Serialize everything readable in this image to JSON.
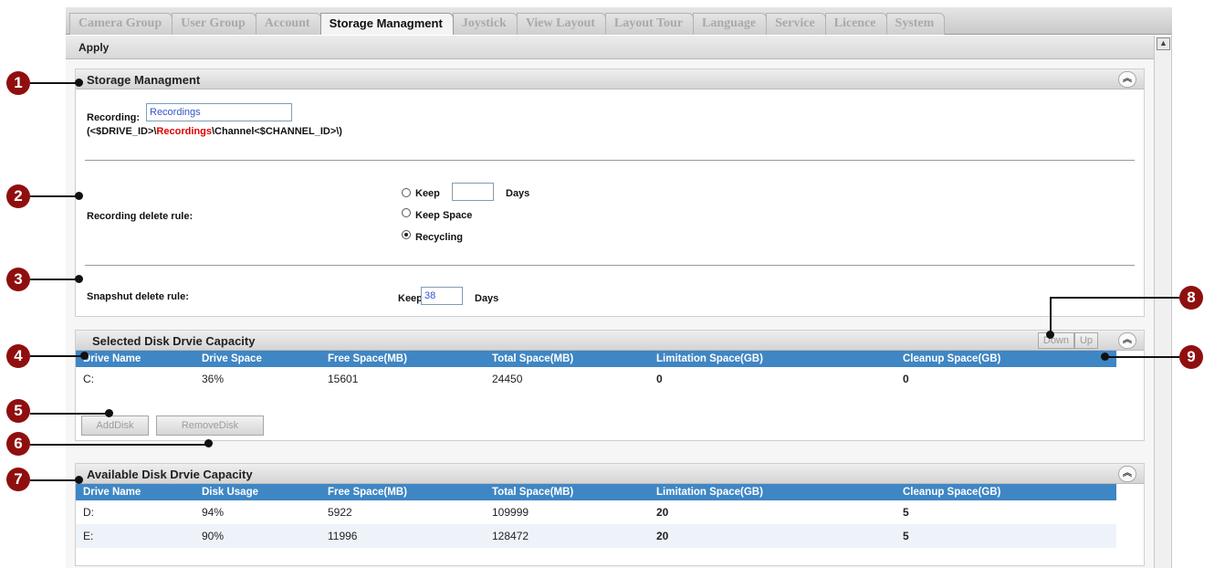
{
  "tabs": [
    "Camera Group",
    "User Group",
    "Account",
    "Storage Managment",
    "Joystick",
    "View Layout",
    "Layout Tour",
    "Language",
    "Service",
    "Licence",
    "System"
  ],
  "active_tab": "Storage Managment",
  "toolbar": {
    "apply_label": "Apply"
  },
  "storage": {
    "title": "Storage Managment",
    "recording_label": "Recording:",
    "recording_value": "Recordings",
    "path_prefix": "(<$DRIVE_ID>\\",
    "path_highlight": "Recordings",
    "path_suffix": "\\Channel<$CHANNEL_ID>\\)",
    "delete_rule_label": "Recording delete rule:",
    "options": [
      {
        "label": "Keep",
        "selected": false,
        "has_days": true,
        "days_value": "",
        "days_label": "Days"
      },
      {
        "label": "Keep Space",
        "selected": false
      },
      {
        "label": "Recycling",
        "selected": true
      }
    ],
    "snapshot_label": "Snapshut delete rule:",
    "snapshot_keep_label": "Keep",
    "snapshot_days_value": "38",
    "snapshot_days_label": "Days"
  },
  "selected_disks": {
    "title": "Selected Disk Drvie Capacity",
    "down_label": "Down",
    "up_label": "Up",
    "columns": [
      "Drive Name",
      "Drive Space",
      "Free Space(MB)",
      "Total Space(MB)",
      "Limitation Space(GB)",
      "Cleanup Space(GB)"
    ],
    "rows": [
      [
        "C:",
        "36%",
        "15601",
        "24450",
        "0",
        "0"
      ]
    ],
    "add_label": "AddDisk",
    "remove_label": "RemoveDisk"
  },
  "available_disks": {
    "title": "Available Disk Drvie Capacity",
    "columns": [
      "Drive Name",
      "Disk Usage",
      "Free Space(MB)",
      "Total Space(MB)",
      "Limitation Space(GB)",
      "Cleanup Space(GB)"
    ],
    "rows": [
      [
        "D:",
        "94%",
        "5922",
        "109999",
        "20",
        "5"
      ],
      [
        "E:",
        "90%",
        "11996",
        "128472",
        "20",
        "5"
      ]
    ]
  },
  "callouts": [
    "1",
    "2",
    "3",
    "4",
    "5",
    "6",
    "7",
    "8",
    "9"
  ],
  "colors": {
    "header_blue": "#3f86c4",
    "callout_red": "#8f0f0f",
    "path_red": "#e00000"
  },
  "icons": {
    "collapse": "double-chevron-up-icon",
    "scroll_up": "arrow-up-icon"
  }
}
